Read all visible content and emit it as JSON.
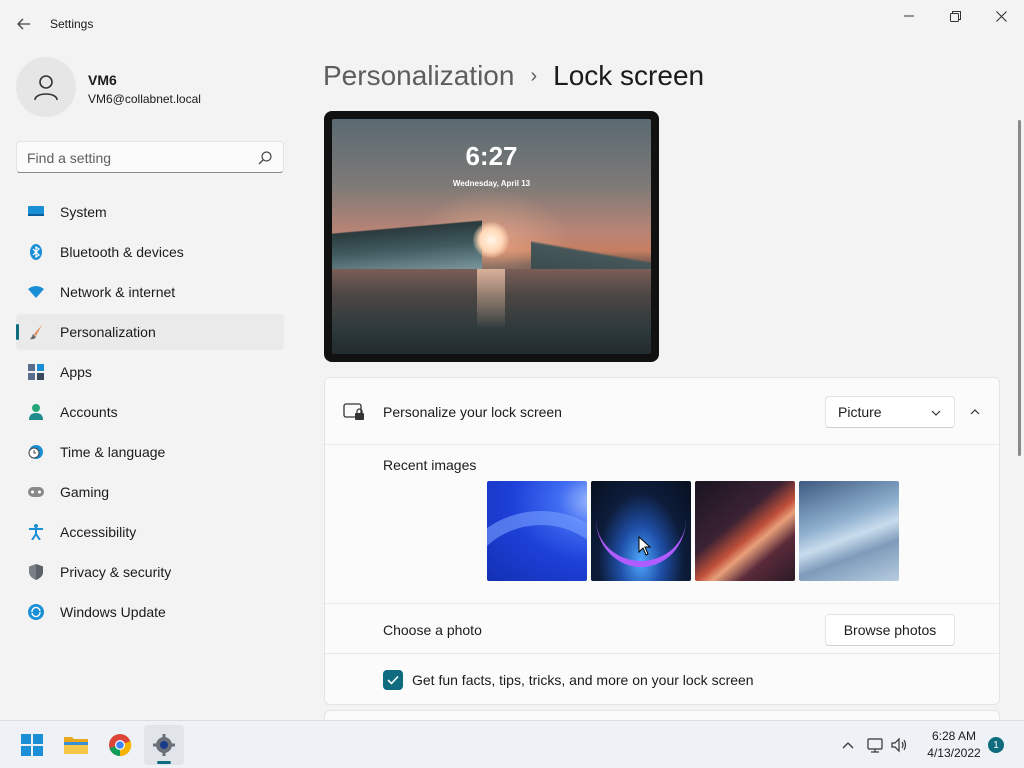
{
  "window": {
    "title": "Settings"
  },
  "user": {
    "name": "VM6",
    "email": "VM6@collabnet.local"
  },
  "search": {
    "placeholder": "Find a setting"
  },
  "sidebar": {
    "items": [
      {
        "label": "System",
        "icon": "system-icon"
      },
      {
        "label": "Bluetooth & devices",
        "icon": "bluetooth-icon"
      },
      {
        "label": "Network & internet",
        "icon": "wifi-icon"
      },
      {
        "label": "Personalization",
        "icon": "brush-icon",
        "active": true
      },
      {
        "label": "Apps",
        "icon": "apps-icon"
      },
      {
        "label": "Accounts",
        "icon": "person-icon"
      },
      {
        "label": "Time & language",
        "icon": "clock-globe-icon"
      },
      {
        "label": "Gaming",
        "icon": "gamepad-icon"
      },
      {
        "label": "Accessibility",
        "icon": "accessibility-icon"
      },
      {
        "label": "Privacy & security",
        "icon": "shield-icon"
      },
      {
        "label": "Windows Update",
        "icon": "update-icon"
      }
    ]
  },
  "breadcrumb": {
    "parent": "Personalization",
    "separator": "›",
    "current": "Lock screen"
  },
  "preview": {
    "time": "6:27",
    "date": "Wednesday, April 13"
  },
  "lock_card": {
    "title": "Personalize your lock screen",
    "dropdown_value": "Picture",
    "recent_label": "Recent images",
    "recent_images": [
      "bloom-blue-wallpaper",
      "glow-dark-wallpaper",
      "ribbon-wallpaper",
      "flow-light-wallpaper"
    ],
    "choose_label": "Choose a photo",
    "browse_button": "Browse photos",
    "facts_label": "Get fun facts, tips, tricks, and more on your lock screen",
    "facts_checked": true
  },
  "taskbar": {
    "time": "6:28 AM",
    "date": "4/13/2022",
    "notification_count": "1"
  },
  "colors": {
    "accent": "#0f6b7e",
    "background": "#f3f3f3",
    "card": "#fbfbfb"
  }
}
